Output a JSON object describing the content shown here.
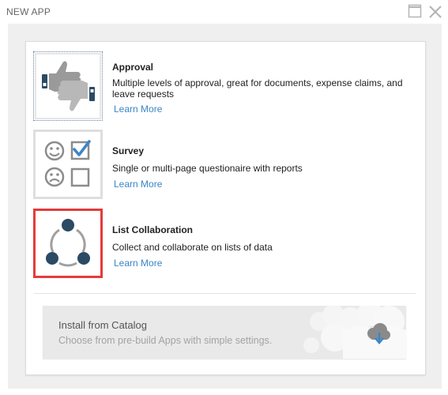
{
  "window": {
    "title": "NEW APP",
    "maximize_icon": "maximize-icon",
    "close_icon": "close-icon"
  },
  "apps": [
    {
      "title": "Approval",
      "description": "Multiple levels of approval, great for documents, expense claims, and leave requests",
      "learn_more": "Learn More",
      "icon": "thumbs-up-down-icon",
      "selected": false
    },
    {
      "title": "Survey",
      "description": "Single or multi-page questionaire with reports",
      "learn_more": "Learn More",
      "icon": "smiley-checkbox-icon",
      "selected": false
    },
    {
      "title": "List Collaboration",
      "description": "Collect and collaborate on lists of data",
      "learn_more": "Learn More",
      "icon": "network-circle-icon",
      "selected": true
    }
  ],
  "catalog": {
    "title": "Install from Catalog",
    "subtitle": "Choose from pre-build Apps with simple settings.",
    "icon": "cloud-download-icon"
  },
  "colors": {
    "accent_link": "#3a86c8",
    "selected_border": "#e53b3b",
    "icon_dark_blue": "#2b4a63",
    "icon_gray": "#a0a0a0"
  }
}
